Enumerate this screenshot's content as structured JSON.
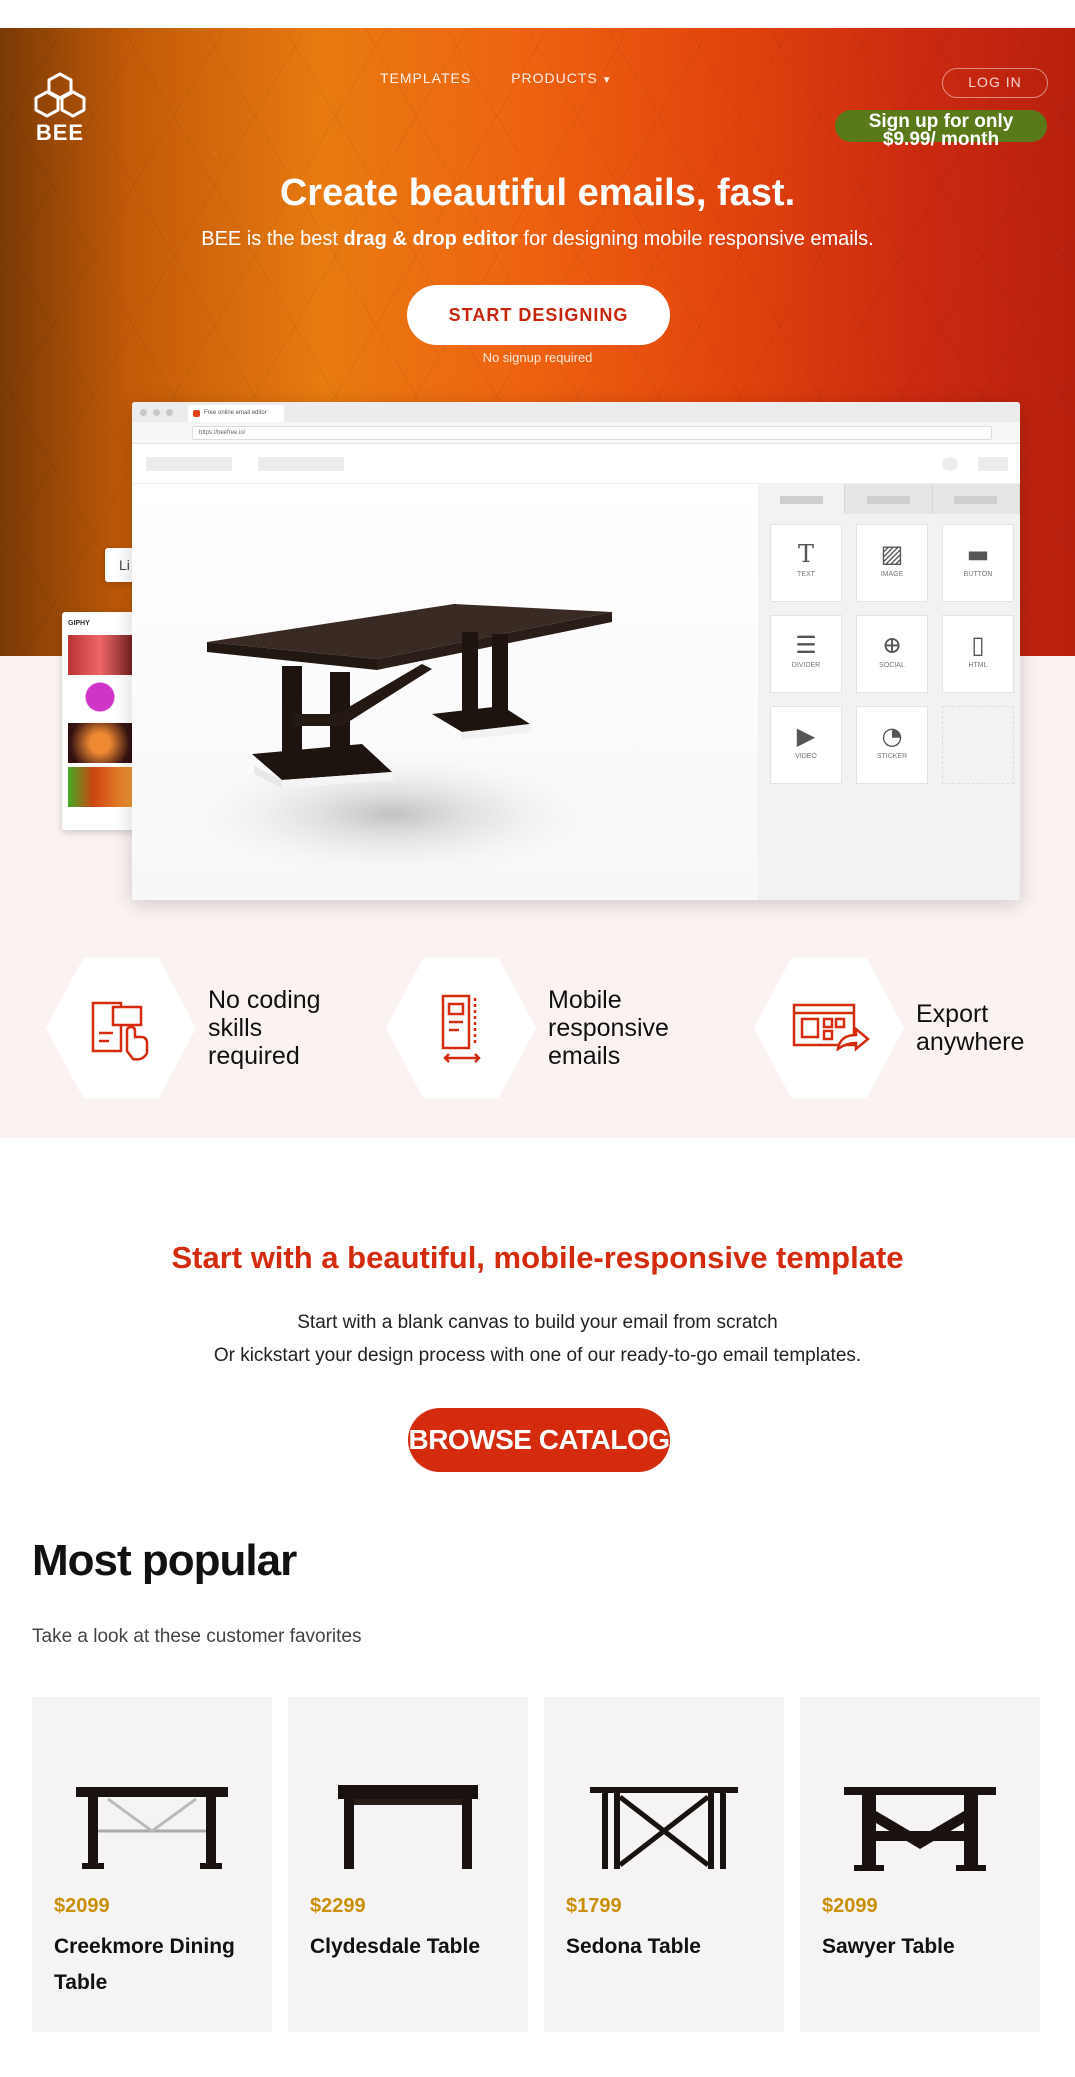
{
  "brand": {
    "name": "BEE"
  },
  "nav": {
    "items": [
      {
        "label": "TEMPLATES",
        "dropdown": false
      },
      {
        "label": "PRODUCTS",
        "dropdown": true
      }
    ],
    "login_label": "LOG IN"
  },
  "promo": {
    "line1": "Sign up for only",
    "line2": "$9.99/ month"
  },
  "hero": {
    "title": "Create beautiful emails, fast.",
    "subtitle_pre": "BEE is the best ",
    "subtitle_bold": "drag & drop editor",
    "subtitle_post": " for designing mobile responsive emails.",
    "cta_label": "START DESIGNING",
    "cta_note": "No signup required"
  },
  "editor": {
    "tab_label": "Free online email editor",
    "url": "https://beefree.io/",
    "blocks": [
      {
        "label": "TEXT",
        "icon": "text-icon"
      },
      {
        "label": "IMAGE",
        "icon": "image-icon"
      },
      {
        "label": "BUTTON",
        "icon": "button-icon"
      },
      {
        "label": "DIVIDER",
        "icon": "divider-icon"
      },
      {
        "label": "SOCIAL",
        "icon": "social-icon"
      },
      {
        "label": "HTML",
        "icon": "html-icon"
      },
      {
        "label": "VIDEO",
        "icon": "video-icon"
      },
      {
        "label": "STICKER",
        "icon": "sticker-icon"
      }
    ],
    "side_chip": "Li",
    "giphy_label": "GIPHY"
  },
  "features": [
    {
      "lines": [
        "No coding",
        "skills",
        "required"
      ],
      "icon": "no-code-icon"
    },
    {
      "lines": [
        "Mobile",
        "responsive",
        "emails"
      ],
      "icon": "mobile-icon"
    },
    {
      "lines": [
        "Export",
        "anywhere"
      ],
      "icon": "export-icon"
    }
  ],
  "templates": {
    "title": "Start with a beautiful, mobile-responsive template",
    "line1": "Start with a blank canvas to build your email from scratch",
    "line2": "Or kickstart your design process with one of our ready-to-go email templates.",
    "cta_label": "BROWSE  CATALOG"
  },
  "popular": {
    "title": "Most popular",
    "subtitle": "Take a look at these customer favorites",
    "products": [
      {
        "price": "$2099",
        "name": "Creekmore Dining Table"
      },
      {
        "price": "$2299",
        "name": "Clydesdale Table"
      },
      {
        "price": "$1799",
        "name": "Sedona Table"
      },
      {
        "price": "$2099",
        "name": "Sawyer Table"
      }
    ]
  },
  "colors": {
    "brand_red": "#d42a0e",
    "price_gold": "#c9900a",
    "promo_green": "#5a7a1a"
  }
}
